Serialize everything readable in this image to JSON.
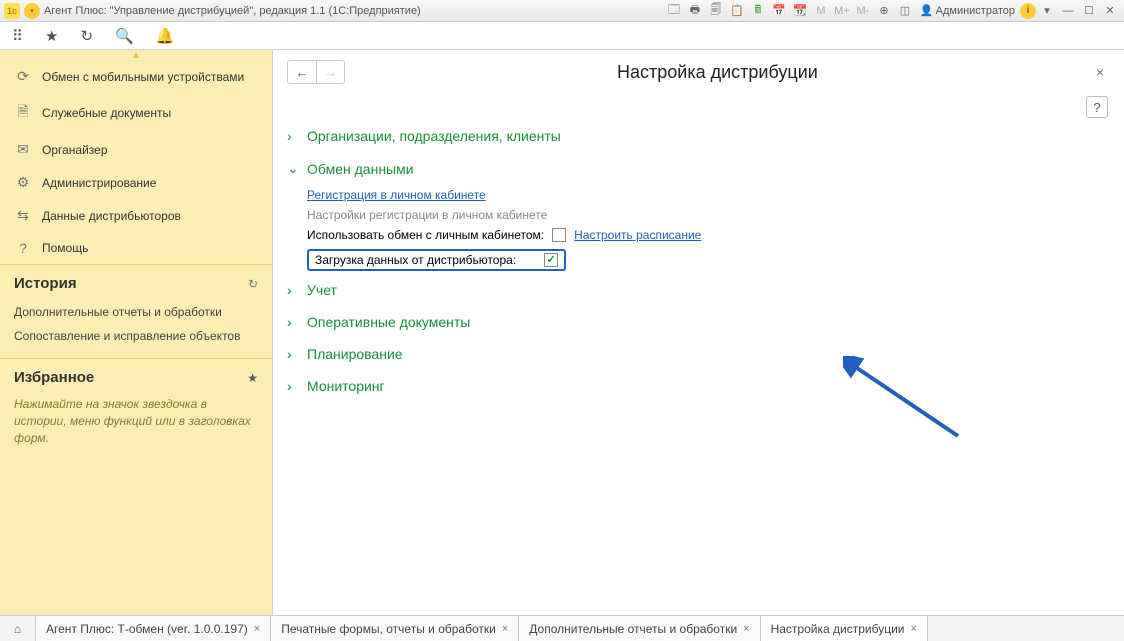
{
  "titlebar": {
    "title": "Агент Плюс: \"Управление дистрибуцией\", редакция 1.1  (1С:Предприятие)",
    "user_label": "Администратор",
    "m1": "M",
    "m2": "M+",
    "m3": "M-"
  },
  "sidebar": {
    "nav": [
      {
        "icon": "refresh",
        "label": "Обмен с мобильными устройствами"
      },
      {
        "icon": "doc",
        "label": "Служебные документы"
      },
      {
        "icon": "organizer",
        "label": "Органайзер"
      },
      {
        "icon": "gear",
        "label": "Администрирование"
      },
      {
        "icon": "data",
        "label": "Данные дистрибьюторов"
      },
      {
        "icon": "help",
        "label": "Помощь"
      }
    ],
    "history": {
      "title": "История",
      "items": [
        "Дополнительные отчеты и обработки",
        "Сопоставление и исправление объектов"
      ]
    },
    "favorites": {
      "title": "Избранное",
      "hint": "Нажимайте на значок звездочка в истории, меню функций или в заголовках форм."
    }
  },
  "content": {
    "page_title": "Настройка дистрибуции",
    "groups": {
      "org": "Организации, подразделения, клиенты",
      "exchange": "Обмен данными",
      "uchet": "Учет",
      "op": "Оперативные документы",
      "plan": "Планирование",
      "mon": "Мониторинг"
    },
    "exchange": {
      "register_link": "Регистрация в личном кабинете",
      "register_hint": "Настройки регистрации в личном кабинете",
      "use_exchange_label": "Использовать обмен с личным кабинетом:",
      "schedule_link": "Настроить расписание",
      "load_label": "Загрузка данных от дистрибьютора:"
    }
  },
  "tabs": {
    "items": [
      "Агент Плюс: Т-обмен (ver. 1.0.0.197)",
      "Печатные формы, отчеты и обработки",
      "Дополнительные отчеты и обработки",
      "Настройка дистрибуции"
    ]
  }
}
